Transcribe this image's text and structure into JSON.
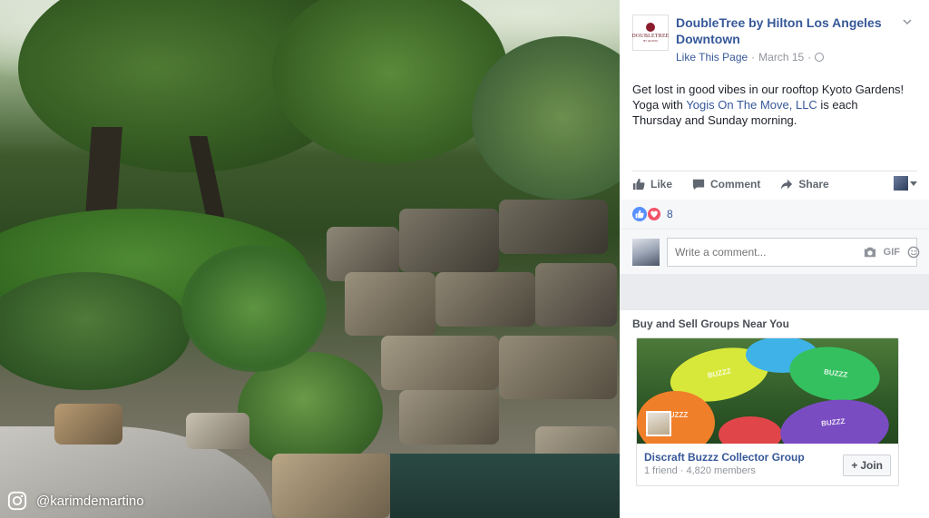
{
  "photo": {
    "watermark": "@karimdemartino",
    "icon": "instagram-icon"
  },
  "post": {
    "page_name": "DoubleTree by Hilton Los Angeles Downtown",
    "logo_text": "DOUBLETREE",
    "logo_subtext": "BY HILTON",
    "like_page": "Like This Page",
    "separator": "·",
    "date": "March 15",
    "text_before": "Get lost in good vibes in our rooftop Kyoto Gardens! Yoga with ",
    "mention": "Yogis On The Move, LLC",
    "text_after": " is each Thursday and Sunday morning.",
    "actions": {
      "like": "Like",
      "comment": "Comment",
      "share": "Share"
    },
    "reaction_count": "8",
    "comment_placeholder": "Write a comment...",
    "gif_label": "GIF"
  },
  "suggestions": {
    "title": "Buy and Sell Groups Near You",
    "group": {
      "name": "Discraft Buzzz Collector Group",
      "meta": "1 friend · 4,820 members",
      "join_label": "Join",
      "disc_label": "BUZZZ"
    }
  },
  "colors": {
    "link": "#365899",
    "meta": "#90949c",
    "like_reaction": "#5890ff",
    "love_reaction": "#f25268"
  }
}
